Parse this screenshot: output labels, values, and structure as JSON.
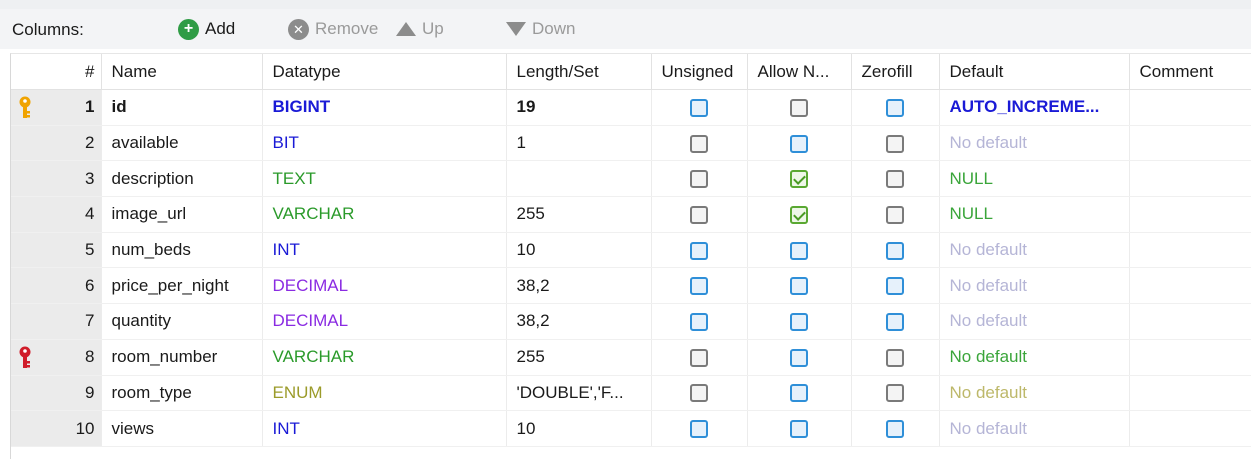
{
  "toolbar": {
    "columns_label": "Columns:",
    "add_label": "Add",
    "remove_label": "Remove",
    "up_label": "Up",
    "down_label": "Down"
  },
  "headers": [
    "#",
    "Name",
    "Datatype",
    "Length/Set",
    "Unsigned",
    "Allow N...",
    "Zerofill",
    "Default",
    "Comment"
  ],
  "colors": {
    "type_blue": "#1a1ad6",
    "type_green": "#2a9a2a",
    "type_purple": "#8a2be2",
    "type_olive": "#9b9b2a",
    "default_gray": "#b5b5d6",
    "default_green": "#3aa53a",
    "default_olive": "#bdb86a",
    "pk_key": "#f0a300",
    "fk_key": "#d01c2a"
  },
  "rows": [
    {
      "key": "primary",
      "num": "1",
      "name": "id",
      "type": "BIGINT",
      "type_color": "#1a1ad6",
      "length": "19",
      "unsigned": "blue",
      "allow_null": "gray",
      "zerofill": "blue",
      "default": "AUTO_INCREME...",
      "default_color": "#1a1ad6",
      "comment": "",
      "bold": true
    },
    {
      "key": "",
      "num": "2",
      "name": "available",
      "type": "BIT",
      "type_color": "#1a1ad6",
      "length": "1",
      "unsigned": "gray",
      "allow_null": "blue",
      "zerofill": "gray",
      "default": "No default",
      "default_color": "#b5b5d6",
      "comment": "",
      "bold": false
    },
    {
      "key": "",
      "num": "3",
      "name": "description",
      "type": "TEXT",
      "type_color": "#2a9a2a",
      "length": "",
      "unsigned": "gray",
      "allow_null": "green",
      "zerofill": "gray",
      "default": "NULL",
      "default_color": "#3aa53a",
      "comment": "",
      "bold": false
    },
    {
      "key": "",
      "num": "4",
      "name": "image_url",
      "type": "VARCHAR",
      "type_color": "#2a9a2a",
      "length": "255",
      "unsigned": "gray",
      "allow_null": "green",
      "zerofill": "gray",
      "default": "NULL",
      "default_color": "#3aa53a",
      "comment": "",
      "bold": false
    },
    {
      "key": "",
      "num": "5",
      "name": "num_beds",
      "type": "INT",
      "type_color": "#1a1ad6",
      "length": "10",
      "unsigned": "blue",
      "allow_null": "blue",
      "zerofill": "blue",
      "default": "No default",
      "default_color": "#b5b5d6",
      "comment": "",
      "bold": false
    },
    {
      "key": "",
      "num": "6",
      "name": "price_per_night",
      "type": "DECIMAL",
      "type_color": "#8a2be2",
      "length": "38,2",
      "unsigned": "blue",
      "allow_null": "blue",
      "zerofill": "blue",
      "default": "No default",
      "default_color": "#b5b5d6",
      "comment": "",
      "bold": false
    },
    {
      "key": "",
      "num": "7",
      "name": "quantity",
      "type": "DECIMAL",
      "type_color": "#8a2be2",
      "length": "38,2",
      "unsigned": "blue",
      "allow_null": "blue",
      "zerofill": "blue",
      "default": "No default",
      "default_color": "#b5b5d6",
      "comment": "",
      "bold": false
    },
    {
      "key": "foreign",
      "num": "8",
      "name": "room_number",
      "type": "VARCHAR",
      "type_color": "#2a9a2a",
      "length": "255",
      "unsigned": "gray",
      "allow_null": "blue",
      "zerofill": "gray",
      "default": "No default",
      "default_color": "#3aa53a",
      "comment": "",
      "bold": false
    },
    {
      "key": "",
      "num": "9",
      "name": "room_type",
      "type": "ENUM",
      "type_color": "#9b9b2a",
      "length": "'DOUBLE','F...",
      "unsigned": "gray",
      "allow_null": "blue",
      "zerofill": "gray",
      "default": "No default",
      "default_color": "#bdb86a",
      "comment": "",
      "bold": false
    },
    {
      "key": "",
      "num": "10",
      "name": "views",
      "type": "INT",
      "type_color": "#1a1ad6",
      "length": "10",
      "unsigned": "blue",
      "allow_null": "blue",
      "zerofill": "blue",
      "default": "No default",
      "default_color": "#b5b5d6",
      "comment": "",
      "bold": false
    }
  ]
}
